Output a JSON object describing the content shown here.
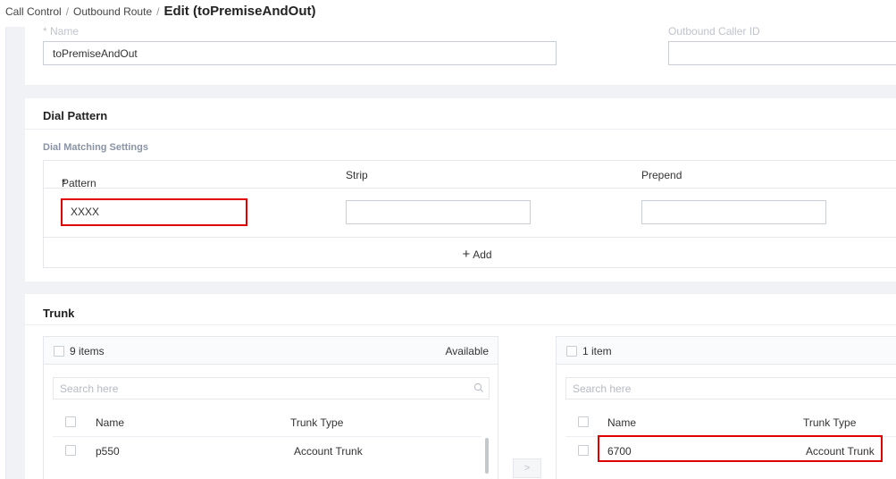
{
  "breadcrumb": {
    "item1": "Call Control",
    "item2": "Outbound Route",
    "separator": "/",
    "current": "Edit (toPremiseAndOut)"
  },
  "general": {
    "name_label": "* Name",
    "name_value": "toPremiseAndOut",
    "caller_id_label": "Outbound Caller ID",
    "caller_id_value": ""
  },
  "dial_pattern": {
    "title": "Dial Pattern",
    "subtitle": "Dial Matching Settings",
    "columns": {
      "required_mark": "*",
      "pattern": "Pattern",
      "strip": "Strip",
      "prepend": "Prepend"
    },
    "row": {
      "pattern": "XXXX",
      "strip": "",
      "prepend": ""
    },
    "add_label": "Add",
    "add_icon": "+"
  },
  "trunk": {
    "title": "Trunk",
    "available": {
      "count": "9 items",
      "caption": "Available",
      "search_placeholder": "Search here",
      "col_name": "Name",
      "col_type": "Trunk Type",
      "rows": [
        {
          "name": "p550",
          "type": "Account Trunk"
        }
      ]
    },
    "selected": {
      "count": "1 item",
      "search_placeholder": "Search here",
      "col_name": "Name",
      "col_type": "Trunk Type",
      "rows": [
        {
          "name": "6700",
          "type": "Account Trunk"
        }
      ]
    },
    "move_icon": ">"
  },
  "colors": {
    "highlight": "#e00000",
    "required": "#e02020"
  }
}
